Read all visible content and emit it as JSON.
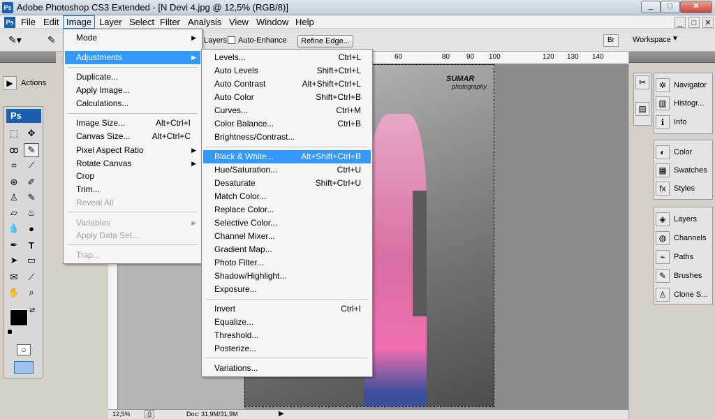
{
  "window": {
    "title": "Adobe Photoshop CS3 Extended - [N Devi 4.jpg @ 12,5% (RGB/8)]",
    "app_icon": "Ps",
    "minimize": "_",
    "restore": "□",
    "close": "✕"
  },
  "menubar": {
    "items": [
      "File",
      "Edit",
      "Image",
      "Layer",
      "Select",
      "Filter",
      "Analysis",
      "View",
      "Window",
      "Help"
    ]
  },
  "options": {
    "layers_label": "Layers",
    "auto_enhance": "Auto-Enhance",
    "refine_edge": "Refine Edge...",
    "workspace": "Workspace"
  },
  "left_panel": {
    "actions": "Actions"
  },
  "toolbox": {
    "logo": "Ps"
  },
  "right_panel": {
    "items": [
      "Navigator",
      "Histogr...",
      "Info",
      "Color",
      "Swatches",
      "Styles",
      "Layers",
      "Channels",
      "Paths",
      "Brushes",
      "Clone S..."
    ]
  },
  "ruler": {
    "ticks": [
      "60",
      "80",
      "90",
      "100",
      "120",
      "130",
      "140"
    ]
  },
  "watermark": {
    "line1": "SUMAR",
    "line2": "photography"
  },
  "status": {
    "zoom": "12,5%",
    "doc": "Doc: 31,9M/31,9M"
  },
  "image_menu": {
    "items": [
      {
        "label": "Mode",
        "sc": "",
        "sub": true,
        "dis": false
      },
      {
        "label": "Adjustments",
        "sc": "",
        "sub": true,
        "dis": false
      },
      {
        "label": "Duplicate...",
        "sc": "",
        "sub": false,
        "dis": false
      },
      {
        "label": "Apply Image...",
        "sc": "",
        "sub": false,
        "dis": false
      },
      {
        "label": "Calculations...",
        "sc": "",
        "sub": false,
        "dis": false
      },
      {
        "label": "Image Size...",
        "sc": "Alt+Ctrl+I",
        "sub": false,
        "dis": false
      },
      {
        "label": "Canvas Size...",
        "sc": "Alt+Ctrl+C",
        "sub": false,
        "dis": false
      },
      {
        "label": "Pixel Aspect Ratio",
        "sc": "",
        "sub": true,
        "dis": false
      },
      {
        "label": "Rotate Canvas",
        "sc": "",
        "sub": true,
        "dis": false
      },
      {
        "label": "Crop",
        "sc": "",
        "sub": false,
        "dis": false
      },
      {
        "label": "Trim...",
        "sc": "",
        "sub": false,
        "dis": false
      },
      {
        "label": "Reveal All",
        "sc": "",
        "sub": false,
        "dis": true
      },
      {
        "label": "Variables",
        "sc": "",
        "sub": true,
        "dis": true
      },
      {
        "label": "Apply Data Set...",
        "sc": "",
        "sub": false,
        "dis": true
      },
      {
        "label": "Trap...",
        "sc": "",
        "sub": false,
        "dis": true
      }
    ]
  },
  "adjust_menu": {
    "items": [
      {
        "label": "Levels...",
        "sc": "Ctrl+L"
      },
      {
        "label": "Auto Levels",
        "sc": "Shift+Ctrl+L"
      },
      {
        "label": "Auto Contrast",
        "sc": "Alt+Shift+Ctrl+L"
      },
      {
        "label": "Auto Color",
        "sc": "Shift+Ctrl+B"
      },
      {
        "label": "Curves...",
        "sc": "Ctrl+M"
      },
      {
        "label": "Color Balance...",
        "sc": "Ctrl+B"
      },
      {
        "label": "Brightness/Contrast...",
        "sc": ""
      },
      {
        "label": "Black & White...",
        "sc": "Alt+Shift+Ctrl+B"
      },
      {
        "label": "Hue/Saturation...",
        "sc": "Ctrl+U"
      },
      {
        "label": "Desaturate",
        "sc": "Shift+Ctrl+U"
      },
      {
        "label": "Match Color...",
        "sc": ""
      },
      {
        "label": "Replace Color...",
        "sc": ""
      },
      {
        "label": "Selective Color...",
        "sc": ""
      },
      {
        "label": "Channel Mixer...",
        "sc": ""
      },
      {
        "label": "Gradient Map...",
        "sc": ""
      },
      {
        "label": "Photo Filter...",
        "sc": ""
      },
      {
        "label": "Shadow/Highlight...",
        "sc": ""
      },
      {
        "label": "Exposure...",
        "sc": ""
      },
      {
        "label": "Invert",
        "sc": "Ctrl+I"
      },
      {
        "label": "Equalize...",
        "sc": ""
      },
      {
        "label": "Threshold...",
        "sc": ""
      },
      {
        "label": "Posterize...",
        "sc": ""
      },
      {
        "label": "Variations...",
        "sc": ""
      }
    ]
  }
}
